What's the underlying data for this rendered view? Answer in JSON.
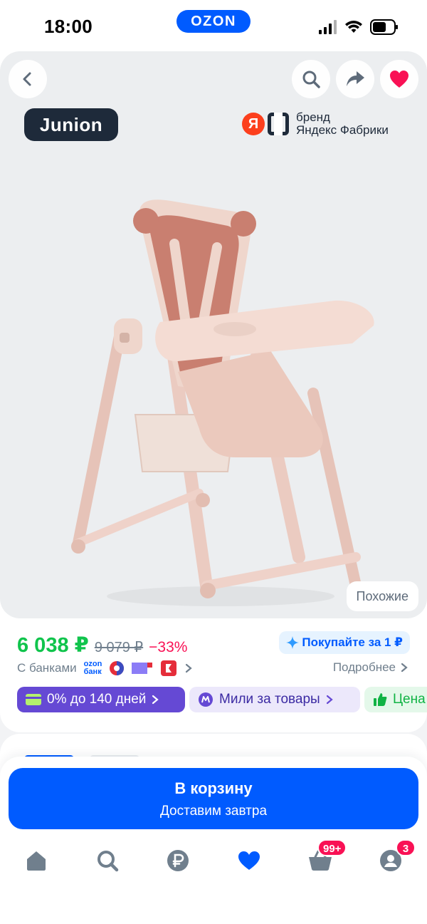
{
  "status_bar": {
    "time": "18:00",
    "app_pill": "OZON"
  },
  "gallery": {
    "brand_logo": "Junion",
    "yandex_badge": {
      "mark": "Я",
      "line1": "бренд",
      "line2": "Яндекс Фабрики"
    },
    "similar_label": "Похожие"
  },
  "price": {
    "current": "6 038 ₽",
    "old": "9 079 ₽",
    "discount": "−33%"
  },
  "promo": {
    "label": "Покупайте за 1 ₽"
  },
  "banks": {
    "label": "С банками",
    "ozon_bank_line1": "ozon",
    "ozon_bank_line2": "банк"
  },
  "details_link": "Подробнее",
  "chips": {
    "installment": "0% до 140 дней",
    "miles": "Мили за товары",
    "price_drop": "Цена"
  },
  "cart": {
    "label": "В корзину",
    "sub": "Доставим завтра"
  },
  "tabs": {
    "cart_badge": "99+",
    "profile_badge": "3"
  },
  "colors": {
    "brand_blue": "#005bff",
    "price_green": "#10c44c",
    "discount_pink": "#f91155",
    "installment_purple": "#6549d4"
  }
}
